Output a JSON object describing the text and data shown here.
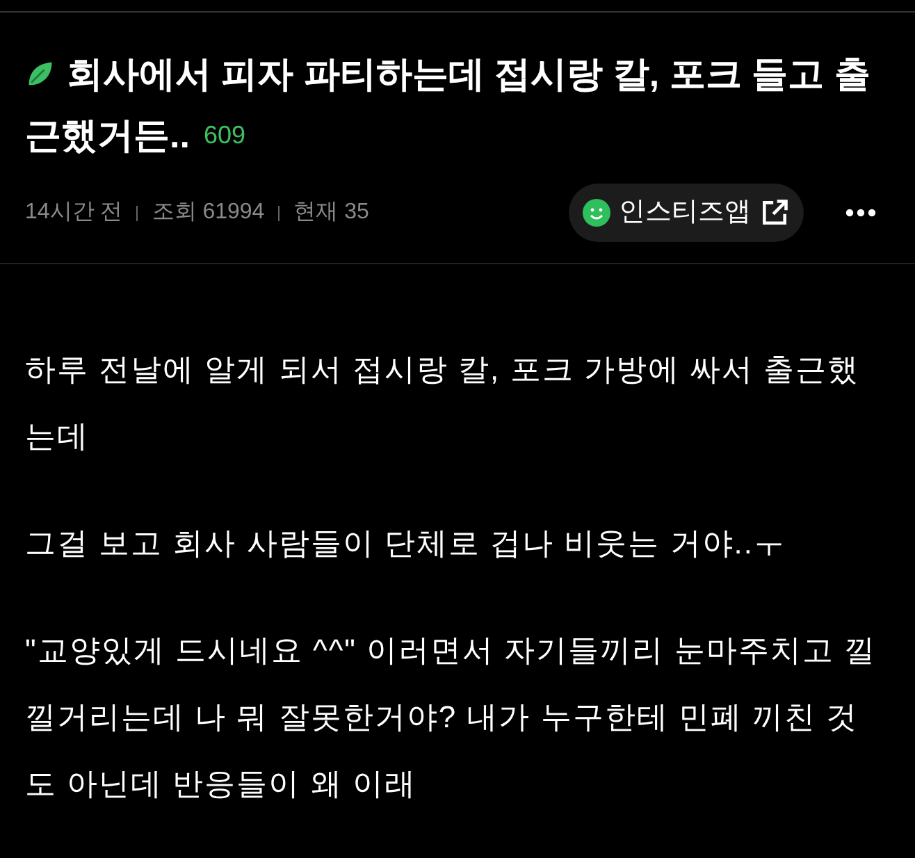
{
  "post": {
    "title_lines": [
      "회사에서 피자 파티하는데 접시랑 칼, 포크 들고 출",
      "근했거든.."
    ],
    "comment_count": "609",
    "time": "14시간 전",
    "views": "조회 61994",
    "current": "현재 35",
    "app_button": "인스티즈앱"
  },
  "body": [
    "하루 전날에 알게 되서 접시랑 칼, 포크 가방에 싸서 출근했는데",
    "그걸 보고 회사 사람들이 단체로 겁나 비웃는 거야..ㅜ",
    "\"교양있게 드시네요 ^^\" 이러면서 자기들끼리 눈마주치고 낄낄거리는데 나 뭐 잘못한거야? 내가 누구한테 민폐 끼친 것도 아닌데 반응들이 왜 이래"
  ]
}
